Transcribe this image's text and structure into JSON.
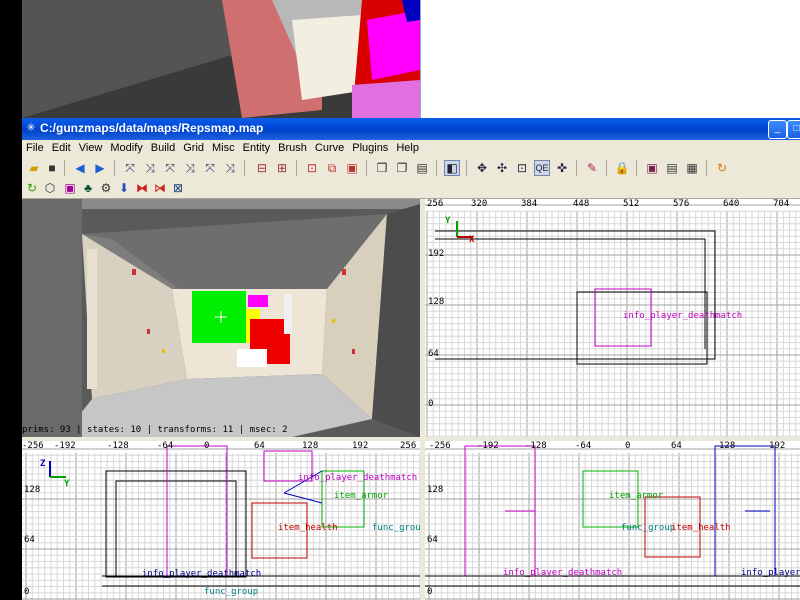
{
  "window": {
    "title": "C:/gunzmaps/data/maps/Repsmap.map",
    "controls": [
      "_",
      "□"
    ]
  },
  "menu": [
    "File",
    "Edit",
    "View",
    "Modify",
    "Build",
    "Grid",
    "Misc",
    "Entity",
    "Brush",
    "Curve",
    "Plugins",
    "Help"
  ],
  "camera": {
    "status": "prims: 93 | states: 10 | transforms: 11 | msec: 2"
  },
  "xy_view": {
    "top_ticks": [
      "256",
      "320",
      "384",
      "448",
      "512",
      "576",
      "640",
      "704"
    ],
    "left_ticks": [
      "192",
      "128",
      "64",
      "0"
    ],
    "axis_v": "Y",
    "axis_h": "X",
    "entity": "info_player_deathmatch"
  },
  "xz_view": {
    "top_ticks": [
      "-256",
      "-192",
      "-128",
      "-64",
      "0",
      "64",
      "128",
      "192",
      "256"
    ],
    "left_ticks": [
      "128",
      "64",
      "0"
    ],
    "axis_v": "Z",
    "axis_h": "Y",
    "entities": [
      "info_player_deathmatch",
      "item_armor",
      "item_health",
      "func_group",
      "info_player_deathmatch",
      "func_group"
    ]
  },
  "yz_view": {
    "top_ticks": [
      "-256",
      "-192",
      "-128",
      "-64",
      "0",
      "64",
      "128",
      "192"
    ],
    "left_ticks": [
      "128",
      "64",
      "0"
    ],
    "entities": [
      "item_armor",
      "func_group",
      "item_health",
      "info_player_deathmatch",
      "info_player_"
    ]
  },
  "colors": {
    "titlebar": "#0046d5",
    "chrome": "#ece9d8",
    "grid_minor": "#d8d8d8",
    "grid_major": "#a0a0a0",
    "entity_magenta": "#c000c0",
    "entity_green": "#00b000",
    "entity_red": "#c00000"
  }
}
